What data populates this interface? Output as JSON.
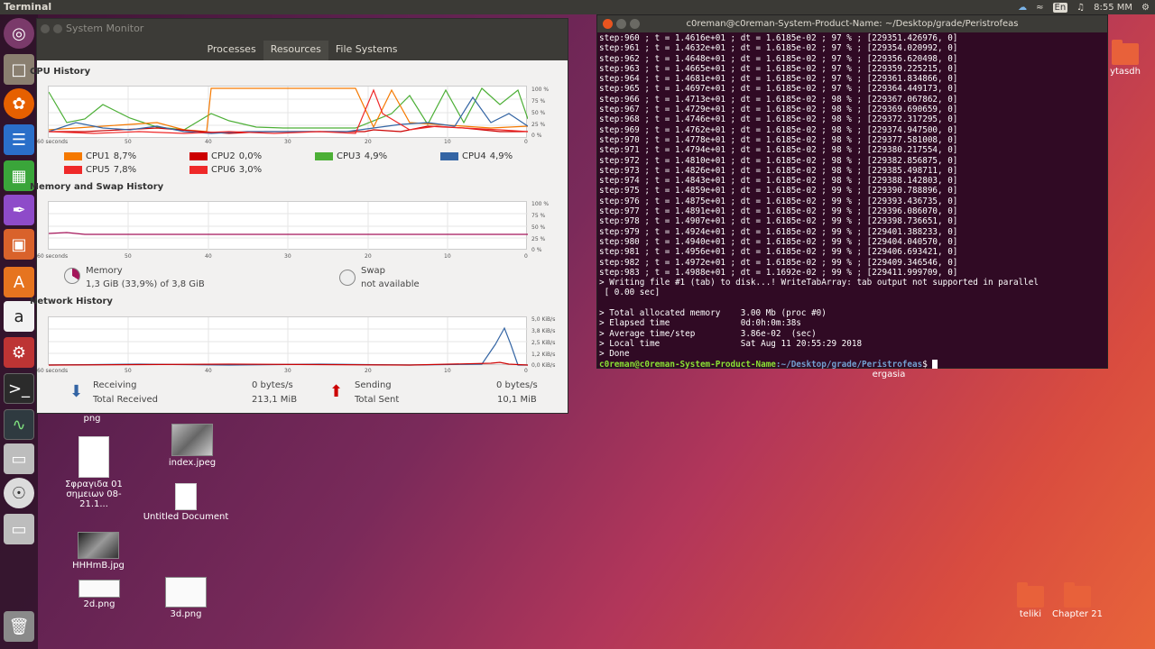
{
  "topbar": {
    "app": "Terminal",
    "lang": "En",
    "time": "8:55 MM"
  },
  "sysmon": {
    "title": "System Monitor",
    "tabs": [
      "Processes",
      "Resources",
      "File Systems"
    ],
    "cpu_title": "CPU History",
    "mem_title": "Memory and Swap History",
    "net_title": "Network History",
    "pct_labels": [
      "100 %",
      "75 %",
      "50 %",
      "25 %",
      "0 %"
    ],
    "kib_labels": [
      "5,0 KiB/s",
      "3,8 KiB/s",
      "2,5 KiB/s",
      "1,2 KiB/s",
      "0,0 KiB/s"
    ],
    "axis_labels": [
      "60 seconds",
      "50",
      "40",
      "30",
      "20",
      "10",
      "0"
    ],
    "cpus": [
      {
        "label": "CPU1",
        "value": "8,7%",
        "color": "#f57900"
      },
      {
        "label": "CPU2",
        "value": "0,0%",
        "color": "#cc0000"
      },
      {
        "label": "CPU3",
        "value": "4,9%",
        "color": "#4caf36"
      },
      {
        "label": "CPU4",
        "value": "4,9%",
        "color": "#3465a4"
      },
      {
        "label": "CPU5",
        "value": "7,8%",
        "color": "#ef2929"
      },
      {
        "label": "CPU6",
        "value": "3,0%",
        "color": "#ef2929"
      }
    ],
    "memory": {
      "label": "Memory",
      "value": "1,3 GiB (33,9%) of 3,8 GiB"
    },
    "swap": {
      "label": "Swap",
      "value": "not available"
    },
    "network": {
      "receiving": "Receiving",
      "receiving_rate": "0 bytes/s",
      "total_received": "Total Received",
      "total_received_val": "213,1 MiB",
      "sending": "Sending",
      "sending_rate": "0 bytes/s",
      "total_sent": "Total Sent",
      "total_sent_val": "10,1 MiB"
    }
  },
  "terminal": {
    "title": "c0reman@c0reman-System-Product-Name: ~/Desktop/grade/Peristrofeas",
    "lines": [
      "step:960 ; t = 1.4616e+01 ; dt = 1.6185e-02 ; 97 % ; [229351.426976, 0]",
      "step:961 ; t = 1.4632e+01 ; dt = 1.6185e-02 ; 97 % ; [229354.020992, 0]",
      "step:962 ; t = 1.4648e+01 ; dt = 1.6185e-02 ; 97 % ; [229356.620498, 0]",
      "step:963 ; t = 1.4665e+01 ; dt = 1.6185e-02 ; 97 % ; [229359.225215, 0]",
      "step:964 ; t = 1.4681e+01 ; dt = 1.6185e-02 ; 97 % ; [229361.834866, 0]",
      "step:965 ; t = 1.4697e+01 ; dt = 1.6185e-02 ; 97 % ; [229364.449173, 0]",
      "step:966 ; t = 1.4713e+01 ; dt = 1.6185e-02 ; 98 % ; [229367.067862, 0]",
      "step:967 ; t = 1.4729e+01 ; dt = 1.6185e-02 ; 98 % ; [229369.690659, 0]",
      "step:968 ; t = 1.4746e+01 ; dt = 1.6185e-02 ; 98 % ; [229372.317295, 0]",
      "step:969 ; t = 1.4762e+01 ; dt = 1.6185e-02 ; 98 % ; [229374.947500, 0]",
      "step:970 ; t = 1.4778e+01 ; dt = 1.6185e-02 ; 98 % ; [229377.581008, 0]",
      "step:971 ; t = 1.4794e+01 ; dt = 1.6185e-02 ; 98 % ; [229380.217554, 0]",
      "step:972 ; t = 1.4810e+01 ; dt = 1.6185e-02 ; 98 % ; [229382.856875, 0]",
      "step:973 ; t = 1.4826e+01 ; dt = 1.6185e-02 ; 98 % ; [229385.498711, 0]",
      "step:974 ; t = 1.4843e+01 ; dt = 1.6185e-02 ; 98 % ; [229388.142803, 0]",
      "step:975 ; t = 1.4859e+01 ; dt = 1.6185e-02 ; 99 % ; [229390.788896, 0]",
      "step:976 ; t = 1.4875e+01 ; dt = 1.6185e-02 ; 99 % ; [229393.436735, 0]",
      "step:977 ; t = 1.4891e+01 ; dt = 1.6185e-02 ; 99 % ; [229396.086070, 0]",
      "step:978 ; t = 1.4907e+01 ; dt = 1.6185e-02 ; 99 % ; [229398.736651, 0]",
      "step:979 ; t = 1.4924e+01 ; dt = 1.6185e-02 ; 99 % ; [229401.388233, 0]",
      "step:980 ; t = 1.4940e+01 ; dt = 1.6185e-02 ; 99 % ; [229404.040570, 0]",
      "step:981 ; t = 1.4956e+01 ; dt = 1.6185e-02 ; 99 % ; [229406.693421, 0]",
      "step:982 ; t = 1.4972e+01 ; dt = 1.6185e-02 ; 99 % ; [229409.346546, 0]",
      "step:983 ; t = 1.4988e+01 ; dt = 1.1692e-02 ; 99 % ; [229411.999709, 0]",
      "> Writing file #1 (tab) to disk...! WriteTabArray: tab output not supported in parallel",
      " [ 0.00 sec]",
      "",
      "> Total allocated memory    3.00 Mb (proc #0)",
      "> Elapsed time              0d:0h:0m:38s",
      "> Average time/step         3.86e-02  (sec)",
      "> Local time                Sat Aug 11 20:55:29 2018",
      "> Done"
    ],
    "prompt_user": "c0reman@c0reman-System-Product-Name",
    "prompt_path": ":~/Desktop/grade/Peristrofeas",
    "prompt_end": "$ "
  },
  "desktop": {
    "ytasdh": "ytasdh",
    "ergasia": "ergasia",
    "png": "png",
    "sfrag": "Σφραγιδα 01 σημειων 08-21.1...",
    "index": "index.jpeg",
    "untitled": "Untitled Document",
    "hhhmb": "HHHmB.jpg",
    "d2": "2d.png",
    "d3": "3d.png",
    "teliki": "teliki",
    "chapter": "Chapter 21"
  }
}
